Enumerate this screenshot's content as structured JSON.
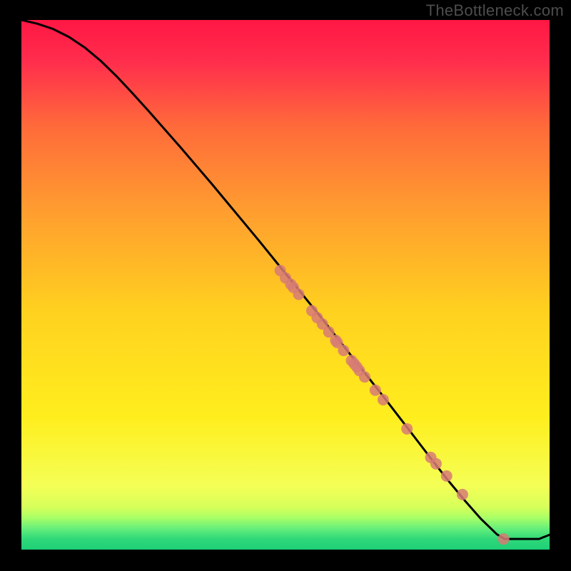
{
  "watermark": "TheBottleneck.com",
  "colors": {
    "bg_black": "#000000",
    "watermark": "#4d4d4d",
    "curve": "#000000",
    "dot_fill": "#d77b74",
    "gradient_top": "#ff1744",
    "gradient_mid_upper": "#ff8a3d",
    "gradient_mid_lower": "#ffe93d",
    "gradient_green": "#3de07d"
  },
  "chart_data": {
    "type": "line",
    "title": "",
    "xlabel": "",
    "ylabel": "",
    "xlim": [
      0,
      100
    ],
    "ylim": [
      0,
      100
    ],
    "curve": {
      "x": [
        0,
        3,
        6,
        9,
        12,
        15,
        18,
        21,
        24,
        27,
        30,
        33,
        36,
        39,
        42,
        45,
        48,
        51,
        54,
        57,
        60,
        63,
        66,
        69,
        72,
        75,
        78,
        81,
        84,
        87,
        90,
        91.5,
        93,
        95,
        98,
        100
      ],
      "y": [
        100,
        99.3,
        98.3,
        96.8,
        94.8,
        92.3,
        89.4,
        86.2,
        82.9,
        79.5,
        76.1,
        72.6,
        69.1,
        65.5,
        61.9,
        58.3,
        54.6,
        50.9,
        47.2,
        43.5,
        39.7,
        35.9,
        32.1,
        28.3,
        24.4,
        20.5,
        16.6,
        12.8,
        9.2,
        5.8,
        2.9,
        2.0,
        2.0,
        2.0,
        2.0,
        2.8
      ]
    },
    "series": [
      {
        "name": "points",
        "x": [
          49.0,
          50.0,
          51.0,
          51.5,
          52.5,
          55.0,
          56.0,
          57.0,
          58.2,
          59.5,
          59.8,
          61.0,
          62.5,
          63.0,
          63.5,
          64.0,
          65.0,
          67.0,
          68.5,
          73.0,
          77.5,
          78.5,
          80.5,
          83.5,
          91.3
        ],
        "y": [
          52.7,
          51.3,
          50.1,
          49.5,
          48.2,
          45.1,
          43.8,
          42.6,
          41.1,
          39.5,
          39.1,
          37.6,
          35.7,
          35.1,
          34.5,
          33.8,
          32.6,
          30.1,
          28.3,
          22.8,
          17.4,
          16.2,
          13.9,
          10.4,
          2.0
        ]
      }
    ]
  }
}
